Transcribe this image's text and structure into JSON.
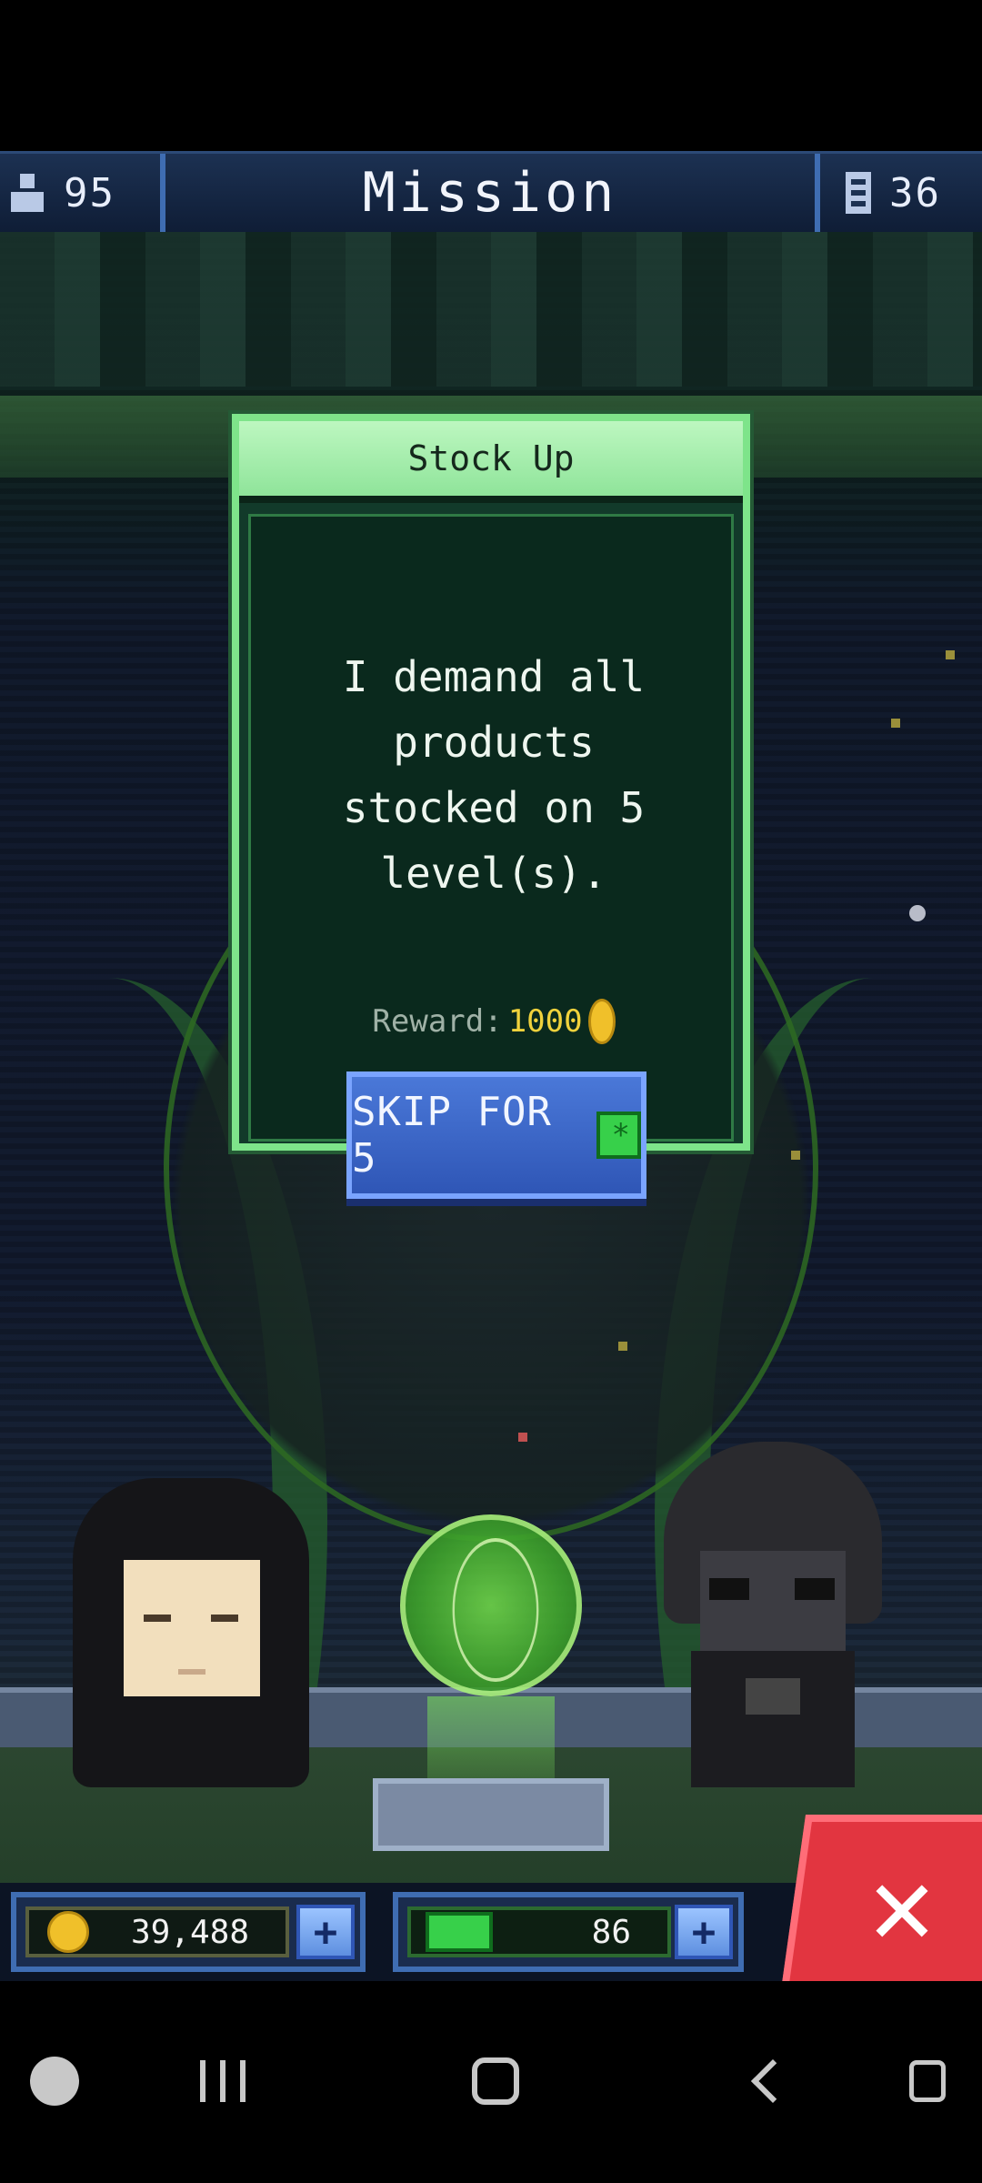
{
  "header": {
    "population": "95",
    "title": "Mission",
    "floors": "36"
  },
  "dialog": {
    "title": "Stock Up",
    "line1": "I demand all products",
    "line2": "stocked on 5 level(s).",
    "reward_label": "Reward:",
    "reward_amount": "1000",
    "skip_label": "SKIP FOR 5"
  },
  "wallet": {
    "coins": "39,488",
    "bux": "86",
    "plus_label": "+"
  },
  "close_label": "✕",
  "colors": {
    "dialog_border": "#7ee48a",
    "skip_button": "#2f56b6",
    "close_button": "#e23540",
    "coin": "#f0c02a",
    "bux": "#37d04a"
  },
  "icons": {
    "population": "person-icon",
    "floors": "floors-icon",
    "coin": "coin-icon",
    "bux": "bux-icon",
    "close": "close-icon"
  },
  "navbar": [
    "game-launcher",
    "recent-apps",
    "home",
    "back",
    "assistant"
  ]
}
